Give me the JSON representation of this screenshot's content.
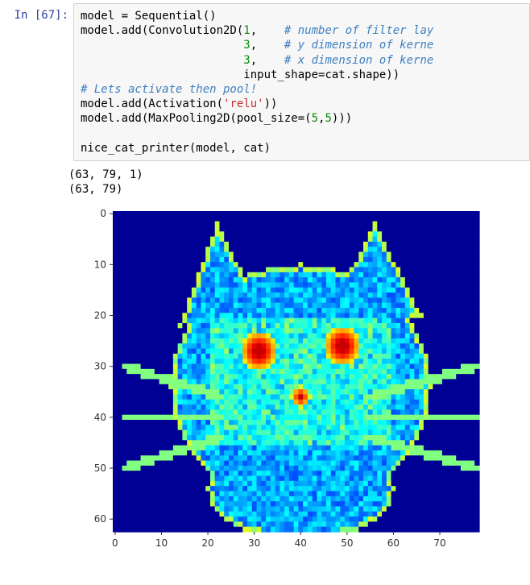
{
  "prompt": "In [67]:",
  "code": {
    "l1_a": "model = Sequential()",
    "l2_a": "model.add(Convolution2D(",
    "l2_n": "1",
    "l2_b": ",    ",
    "l2_c": "# number of filter lay",
    "l3_pad": "                        ",
    "l3_n": "3",
    "l3_b": ",    ",
    "l3_c": "# y dimension of kerne",
    "l4_pad": "                        ",
    "l4_n": "3",
    "l4_b": ",    ",
    "l4_c": "# x dimension of kerne",
    "l5_pad": "                        ",
    "l5_a": "input_shape=cat.shape))",
    "l6_c": "# Lets activate then pool!",
    "l7_a": "model.add(Activation(",
    "l7_s": "'relu'",
    "l7_b": "))",
    "l8_a": "model.add(MaxPooling2D(pool_size=(",
    "l8_n1": "5",
    "l8_mid": ",",
    "l8_n2": "5",
    "l8_b": ")))",
    "l9": "",
    "l10_a": "nice_cat_printer(model, cat)"
  },
  "output": {
    "line1": "(63, 79, 1)",
    "line2": "(63, 79)"
  },
  "chart_data": {
    "type": "heatmap",
    "title": "",
    "xlabel": "",
    "ylabel": "",
    "x_ticks": [
      0,
      10,
      20,
      30,
      40,
      50,
      60,
      70
    ],
    "y_ticks": [
      0,
      10,
      20,
      30,
      40,
      50,
      60
    ],
    "xlim": [
      0,
      78
    ],
    "ylim": [
      0,
      62
    ],
    "description": "Feature-map heatmap output of CNN layer applied to a cat image; colormap jet-style (dark blue background, blue/cyan cat body and head, green edge outlines on ears/face/whiskers, yellow-red hot spots around eyes/nose)."
  }
}
